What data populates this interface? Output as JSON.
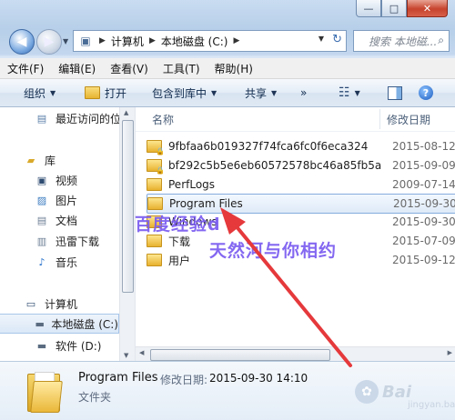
{
  "window": {
    "min_glyph": "—",
    "max_glyph": "□",
    "close_glyph": "✕"
  },
  "nav": {
    "back_glyph": "◀",
    "forward_glyph": "▶"
  },
  "address": {
    "crumbs": [
      "计算机",
      "本地磁盘 (C:)"
    ],
    "separator": "▶",
    "refresh_glyph": "↻"
  },
  "search": {
    "placeholder": "搜索 本地磁盘 (C:)",
    "visible_text": "搜索 本地磁...",
    "icon": "search-icon"
  },
  "menubar": [
    "文件(F)",
    "编辑(E)",
    "查看(V)",
    "工具(T)",
    "帮助(H)"
  ],
  "toolbar": {
    "organize": "组织",
    "open": "打开",
    "include_in_library": "包含到库中",
    "share": "共享",
    "more": "»"
  },
  "sidebar": {
    "items": [
      {
        "label": "最近访问的位",
        "icon": "recent-places-icon"
      },
      {
        "label": "库",
        "icon": "library-icon"
      },
      {
        "label": "视频",
        "icon": "video-library-icon"
      },
      {
        "label": "图片",
        "icon": "pictures-library-icon"
      },
      {
        "label": "文档",
        "icon": "documents-library-icon"
      },
      {
        "label": "迅雷下载",
        "icon": "thunder-download-icon"
      },
      {
        "label": "音乐",
        "icon": "music-library-icon"
      },
      {
        "label": "计算机",
        "icon": "computer-icon"
      },
      {
        "label": "本地磁盘 (C:)",
        "icon": "drive-c-icon"
      },
      {
        "label": "软件 (D:)",
        "icon": "drive-d-icon"
      }
    ]
  },
  "list": {
    "columns": {
      "name": "名称",
      "date": "修改日期"
    },
    "rows": [
      {
        "name": "9fbfaa6b019327f74fca6fc0f6eca324",
        "date": "2015-08-12"
      },
      {
        "name": "bf292c5b5e6eb60572578bc46a85fb5a",
        "date": "2015-09-09"
      },
      {
        "name": "PerfLogs",
        "date": "2009-07-14"
      },
      {
        "name": "Program Files",
        "date": "2015-09-30"
      },
      {
        "name": "Windows",
        "date": "2015-09-30"
      },
      {
        "name": "下载",
        "date": "2015-07-09"
      },
      {
        "name": "用户",
        "date": "2015-09-12"
      }
    ],
    "selected": "Program Files"
  },
  "details": {
    "name": "Program Files",
    "date_label": "修改日期:",
    "date_value": "2015-09-30 14:10",
    "type": "文件夹"
  },
  "annotations": {
    "line1": "百度经验d",
    "line2": "天然河与你相约"
  },
  "watermark": {
    "text": "Bai",
    "sub": "jingyan.baidu.com"
  },
  "colors": {
    "annotation": "#7a5cf0",
    "arrow": "#e5393c",
    "selection": "#deeaf8"
  }
}
